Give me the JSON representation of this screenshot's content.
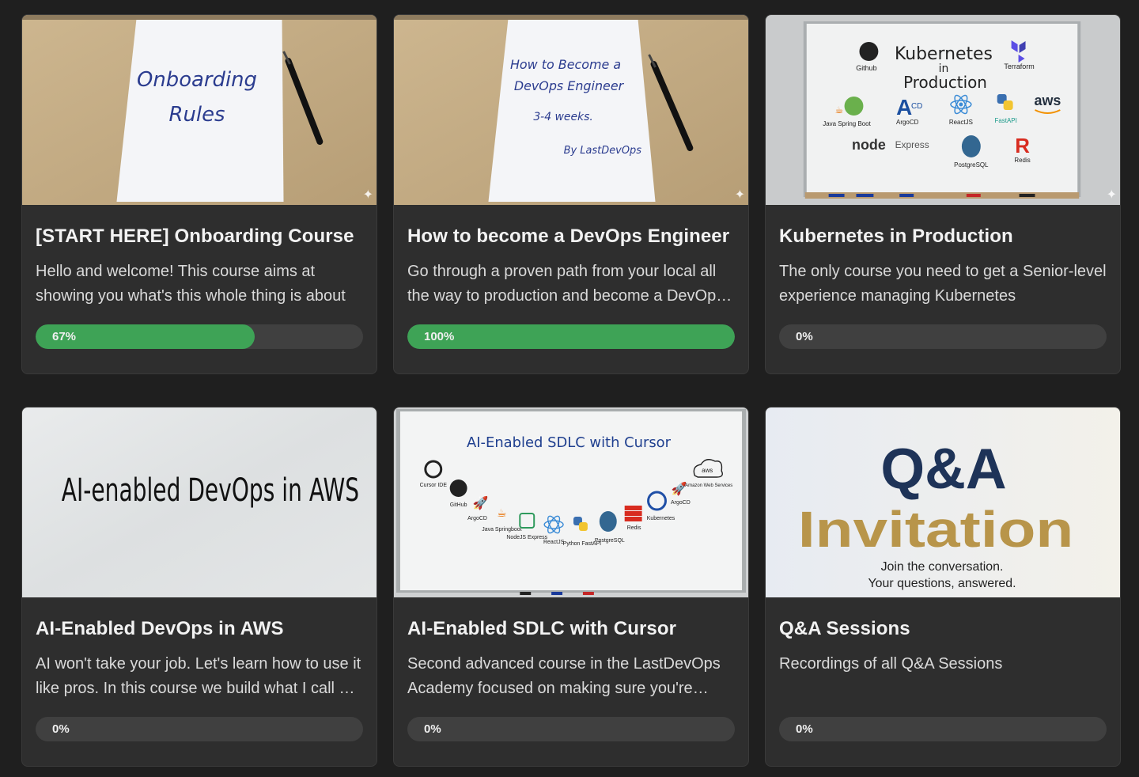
{
  "courses": [
    {
      "title": "[START HERE] Onboarding Course",
      "description": "Hello and welcome! This course aims at showing you what's this whole thing is about",
      "progress": 0.67,
      "progress_label": "67%",
      "thumbnail": {
        "line1": "Onboarding",
        "line2": "Rules"
      }
    },
    {
      "title": "How to become a DevOps Engineer",
      "description": "Go through a proven path from your local all the way to production and become a DevOps Engineer",
      "progress": 1.0,
      "progress_label": "100%",
      "thumbnail": {
        "line1": "How to Become a",
        "line2": "DevOps Engineer",
        "line3": "3-4 weeks.",
        "line4": "By LastDevOps"
      }
    },
    {
      "title": "Kubernetes in Production",
      "description": "The only course you need to get a Senior-level experience managing Kubernetes",
      "progress": 0,
      "progress_label": "0%",
      "thumbnail": {
        "heading1": "Kubernetes",
        "heading2": "in",
        "heading3": "Production",
        "logos": [
          "Github",
          "Terraform",
          "Java Spring Boot",
          "ArgoCD",
          "ReactJS",
          "FastAPI",
          "aws",
          "node",
          "Express",
          "PostgreSQL",
          "Redis"
        ]
      }
    },
    {
      "title": "AI-Enabled DevOps in AWS",
      "description": "AI won't take your job. Let's learn how to use it like pros. In this course we build what I call an AI-enabled DevOps workflow",
      "progress": 0,
      "progress_label": "0%",
      "thumbnail": {
        "text": "AI-enabled DevOps in AWS"
      }
    },
    {
      "title": "AI-Enabled SDLC with Cursor",
      "description": "Second advanced course in the LastDevOps Academy focused on making sure you're shipping faster",
      "progress": 0,
      "progress_label": "0%",
      "thumbnail": {
        "heading": "AI-Enabled SDLC with Cursor",
        "logos": [
          "Cursor IDE",
          "GitHub",
          "ArgoCD",
          "Java Springboot",
          "NodeJS Express",
          "ReactJS",
          "Python FastAPI",
          "PostgreSQL",
          "Redis",
          "Kubernetes",
          "ArgoCD",
          "Amazon Web Services"
        ]
      }
    },
    {
      "title": "Q&A Sessions",
      "description": "Recordings of all Q&A Sessions",
      "progress": 0,
      "progress_label": "0%",
      "thumbnail": {
        "line1": "Q&A",
        "line2": "Invitation",
        "line3": "Join the conversation.",
        "line4": "Your questions, answered."
      }
    }
  ],
  "colors": {
    "background": "#1f1f1f",
    "card": "#2e2e2e",
    "progress_track": "#404040",
    "progress_fill": "#3ea356",
    "qa_navy": "#1e3358",
    "qa_gold": "#b8954a"
  },
  "icons": {
    "thumbnail_badge": "sparkle-icon"
  }
}
